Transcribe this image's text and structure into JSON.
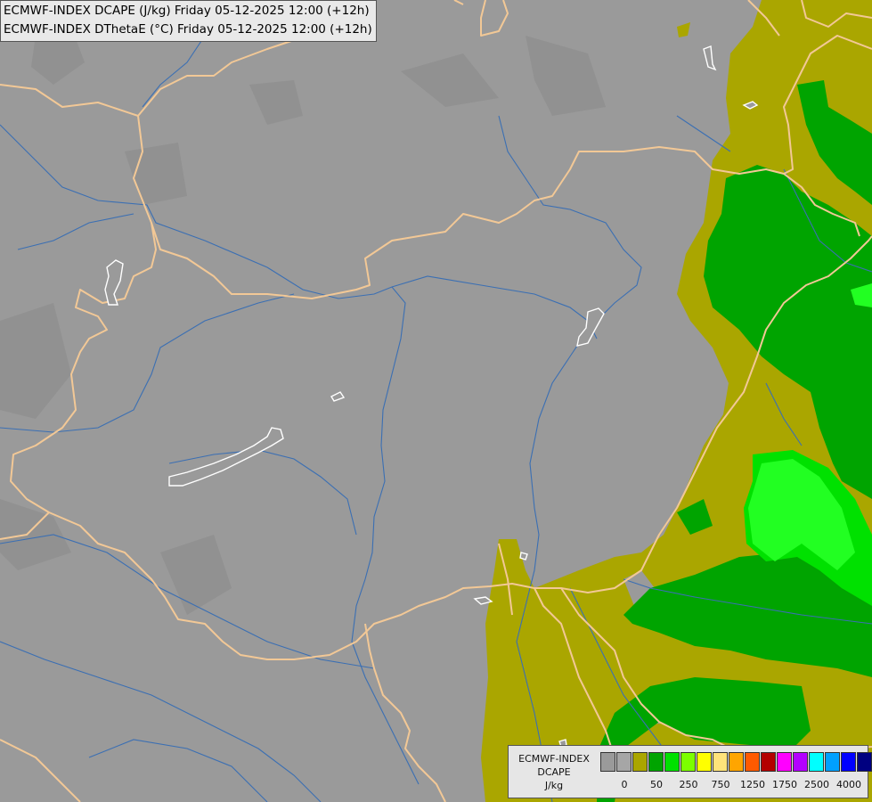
{
  "titles": {
    "line1": "ECMWF-INDEX DCAPE (J/kg) Friday 05-12-2025 12:00 (+12h)",
    "line2": "ECMWF-INDEX DThetaE (°C) Friday 05-12-2025 12:00 (+12h)"
  },
  "legend": {
    "line1": "ECMWF-INDEX",
    "line2": "DCAPE",
    "unit": "J/kg",
    "colors": [
      "#9a9a9a",
      "#a6a6a6",
      "#aaa600",
      "#00a400",
      "#00e100",
      "#7cff00",
      "#ffff00",
      "#ffe37a",
      "#ffa500",
      "#ff5a00",
      "#b40000",
      "#ff00ff",
      "#b400ff",
      "#00ffff",
      "#00a0ff",
      "#0000ff",
      "#000080"
    ],
    "tick_labels": [
      "0",
      "50",
      "250",
      "750",
      "1250",
      "1750",
      "2500",
      "4000"
    ]
  },
  "map_colors": {
    "background": "#9a9a9a",
    "dark_shade": "#8e8e8e",
    "olive": "#aaa600",
    "green": "#00a400",
    "light_green": "#00e100",
    "bright_green": "#22ff22",
    "pale_green": "#7fd07f",
    "border": "#f2c896",
    "river": "#3b6fb3",
    "lake": "#ffffff"
  }
}
